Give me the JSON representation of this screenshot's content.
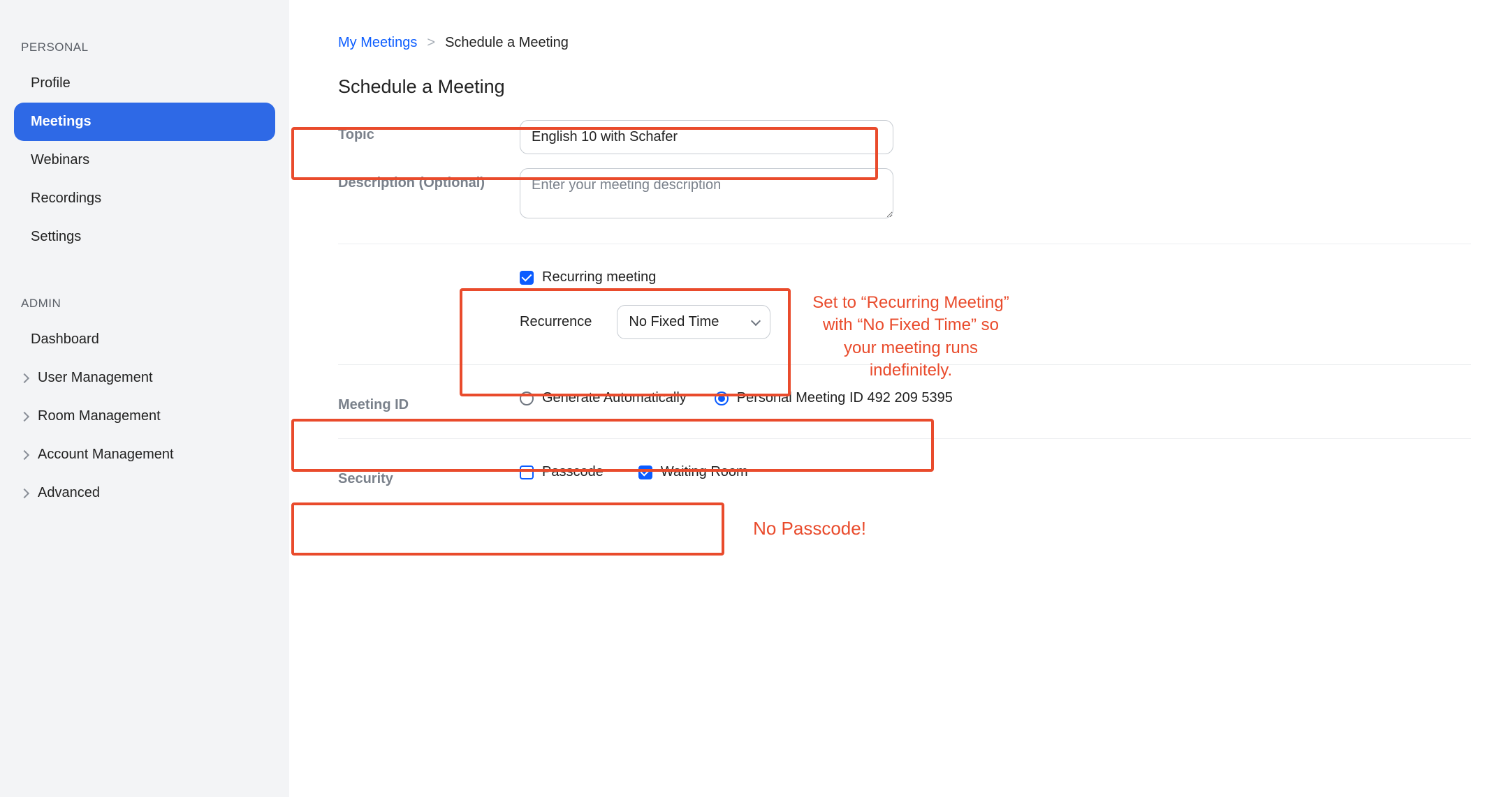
{
  "sidebar": {
    "personal_label": "PERSONAL",
    "items_personal": [
      {
        "label": "Profile"
      },
      {
        "label": "Meetings"
      },
      {
        "label": "Webinars"
      },
      {
        "label": "Recordings"
      },
      {
        "label": "Settings"
      }
    ],
    "admin_label": "ADMIN",
    "items_admin": [
      {
        "label": "Dashboard"
      },
      {
        "label": "User Management"
      },
      {
        "label": "Room Management"
      },
      {
        "label": "Account Management"
      },
      {
        "label": "Advanced"
      }
    ]
  },
  "breadcrumb": {
    "parent": "My Meetings",
    "current": "Schedule a Meeting"
  },
  "page_title": "Schedule a Meeting",
  "fields": {
    "topic_label": "Topic",
    "topic_value": "English 10 with Schafer",
    "description_label": "Description (Optional)",
    "description_placeholder": "Enter your meeting description",
    "recurring_label": "Recurring meeting",
    "recurrence_label": "Recurrence",
    "recurrence_value": "No Fixed Time",
    "meeting_id_label": "Meeting ID",
    "meeting_id_opt1": "Generate Automatically",
    "meeting_id_opt2": "Personal Meeting ID 492 209 5395",
    "security_label": "Security",
    "passcode_label": "Passcode",
    "waiting_room_label": "Waiting Room"
  },
  "annotations": {
    "recurring_note": "Set to “Recurring Meeting” with “No Fixed Time” so your meeting runs indefinitely.",
    "no_passcode": "No Passcode!"
  }
}
